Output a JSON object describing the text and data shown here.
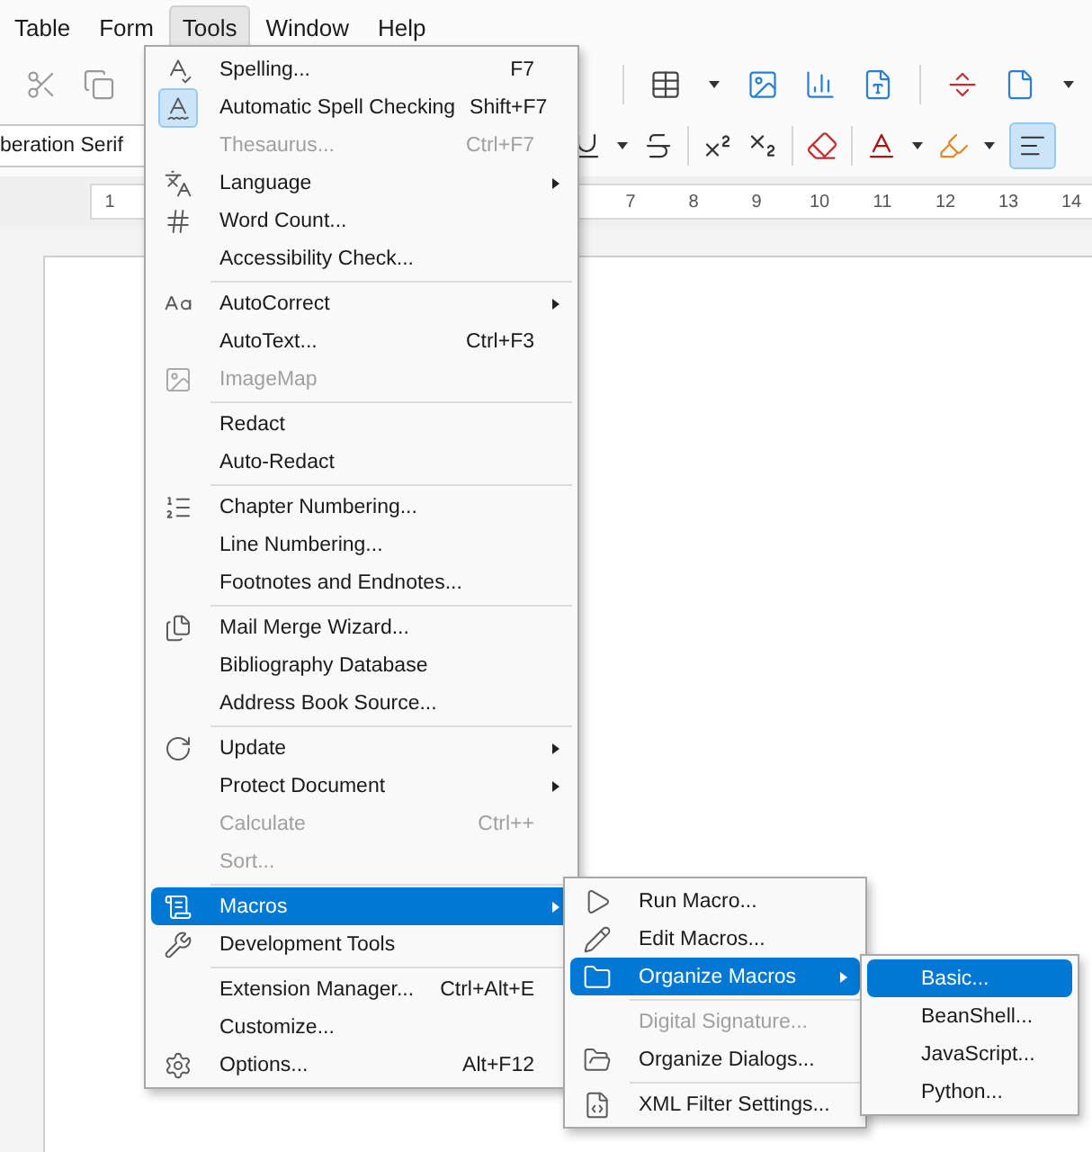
{
  "menubar": [
    {
      "label": "Table",
      "selected": false
    },
    {
      "label": "Form",
      "selected": false
    },
    {
      "label": "Tools",
      "selected": true
    },
    {
      "label": "Window",
      "selected": false
    },
    {
      "label": "Help",
      "selected": false
    }
  ],
  "format_toolbar": {
    "font_name": "beration Serif",
    "align_left_selected": true
  },
  "ruler": {
    "labels": [
      "1",
      "7",
      "8",
      "9",
      "10",
      "11",
      "12",
      "13",
      "14"
    ]
  },
  "tools_menu": {
    "groups": [
      [
        {
          "label": "Spelling...",
          "shortcut": "F7",
          "submenu": false,
          "disabled": false,
          "checked": false,
          "selected": false
        },
        {
          "label": "Automatic Spell Checking",
          "shortcut": "Shift+F7",
          "submenu": false,
          "disabled": false,
          "checked": true,
          "selected": false
        },
        {
          "label": "Thesaurus...",
          "shortcut": "Ctrl+F7",
          "submenu": false,
          "disabled": true,
          "checked": false,
          "selected": false
        },
        {
          "label": "Language",
          "submenu": true,
          "disabled": false,
          "checked": false,
          "selected": false
        },
        {
          "label": "Word Count...",
          "submenu": false,
          "disabled": false,
          "checked": false,
          "selected": false
        },
        {
          "label": "Accessibility Check...",
          "submenu": false,
          "disabled": false,
          "checked": false,
          "selected": false
        }
      ],
      [
        {
          "label": "AutoCorrect",
          "submenu": true,
          "disabled": false,
          "checked": false,
          "selected": false
        },
        {
          "label": "AutoText...",
          "shortcut": "Ctrl+F3",
          "submenu": false,
          "disabled": false,
          "checked": false,
          "selected": false
        },
        {
          "label": "ImageMap",
          "submenu": false,
          "disabled": true,
          "checked": false,
          "selected": false
        }
      ],
      [
        {
          "label": "Redact",
          "submenu": false,
          "disabled": false,
          "checked": false,
          "selected": false
        },
        {
          "label": "Auto-Redact",
          "submenu": false,
          "disabled": false,
          "checked": false,
          "selected": false
        }
      ],
      [
        {
          "label": "Chapter Numbering...",
          "submenu": false,
          "disabled": false,
          "checked": false,
          "selected": false
        },
        {
          "label": "Line Numbering...",
          "submenu": false,
          "disabled": false,
          "checked": false,
          "selected": false
        },
        {
          "label": "Footnotes and Endnotes...",
          "submenu": false,
          "disabled": false,
          "checked": false,
          "selected": false
        }
      ],
      [
        {
          "label": "Mail Merge Wizard...",
          "submenu": false,
          "disabled": false,
          "checked": false,
          "selected": false
        },
        {
          "label": "Bibliography Database",
          "submenu": false,
          "disabled": false,
          "checked": false,
          "selected": false
        },
        {
          "label": "Address Book Source...",
          "submenu": false,
          "disabled": false,
          "checked": false,
          "selected": false
        }
      ],
      [
        {
          "label": "Update",
          "submenu": true,
          "disabled": false,
          "checked": false,
          "selected": false
        },
        {
          "label": "Protect Document",
          "submenu": true,
          "disabled": false,
          "checked": false,
          "selected": false
        },
        {
          "label": "Calculate",
          "shortcut": "Ctrl++",
          "submenu": false,
          "disabled": true,
          "checked": false,
          "selected": false
        },
        {
          "label": "Sort...",
          "submenu": false,
          "disabled": true,
          "checked": false,
          "selected": false
        }
      ],
      [
        {
          "label": "Macros",
          "submenu": true,
          "disabled": false,
          "checked": false,
          "selected": true
        },
        {
          "label": "Development Tools",
          "submenu": false,
          "disabled": false,
          "checked": false,
          "selected": false
        }
      ],
      [
        {
          "label": "Extension Manager...",
          "shortcut": "Ctrl+Alt+E",
          "submenu": false,
          "disabled": false,
          "checked": false,
          "selected": false
        },
        {
          "label": "Customize...",
          "submenu": false,
          "disabled": false,
          "checked": false,
          "selected": false
        },
        {
          "label": "Options...",
          "shortcut": "Alt+F12",
          "submenu": false,
          "disabled": false,
          "checked": false,
          "selected": false
        }
      ]
    ]
  },
  "macros_menu": {
    "groups": [
      [
        {
          "label": "Run Macro...",
          "submenu": false,
          "disabled": false,
          "selected": false
        },
        {
          "label": "Edit Macros...",
          "submenu": false,
          "disabled": false,
          "selected": false
        },
        {
          "label": "Organize Macros",
          "submenu": true,
          "disabled": false,
          "selected": true
        }
      ],
      [
        {
          "label": "Digital Signature...",
          "submenu": false,
          "disabled": true,
          "selected": false
        },
        {
          "label": "Organize Dialogs...",
          "submenu": false,
          "disabled": false,
          "selected": false
        }
      ],
      [
        {
          "label": "XML Filter Settings...",
          "submenu": false,
          "disabled": false,
          "selected": false
        }
      ]
    ]
  },
  "organize_menu": {
    "items": [
      {
        "label": "Basic...",
        "selected": true
      },
      {
        "label": "BeanShell...",
        "selected": false
      },
      {
        "label": "JavaScript...",
        "selected": false
      },
      {
        "label": "Python...",
        "selected": false
      }
    ]
  }
}
